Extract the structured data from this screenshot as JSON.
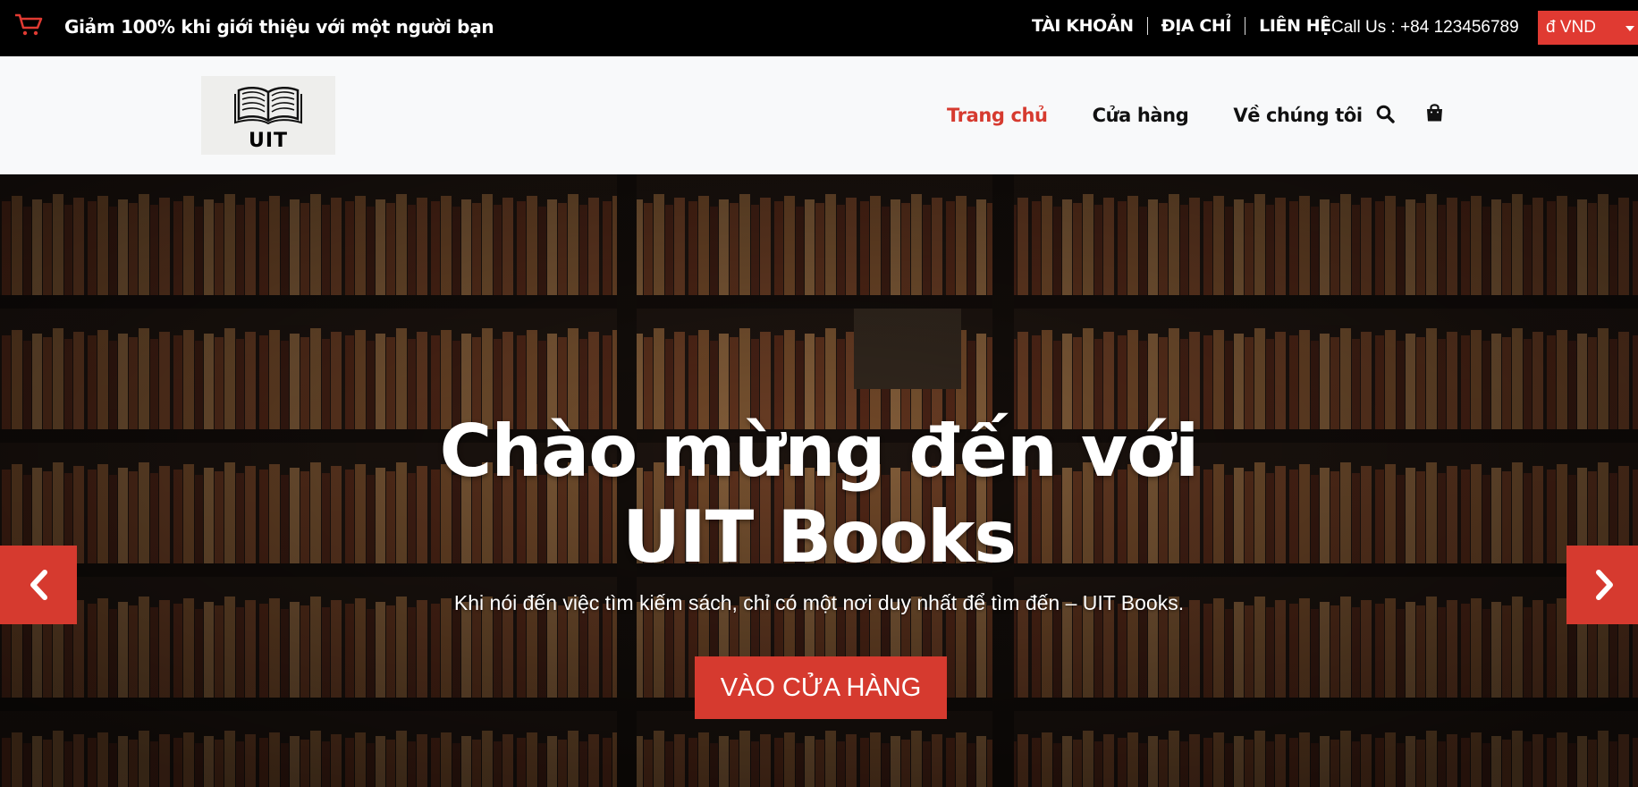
{
  "topbar": {
    "promo_text": "Giảm 100% khi giới thiệu với một người bạn",
    "links": [
      "TÀI KHOẢN",
      "ĐỊA CHỈ",
      "LIÊN HỆ"
    ],
    "phone": "Call Us : +84 123456789",
    "currency": "đ VND",
    "icons": {
      "cart": "cart-icon",
      "currency_caret": "chevron-down-icon"
    }
  },
  "header": {
    "logo_text": "UIT",
    "nav": [
      "Trang chủ",
      "Cửa hàng",
      "Về chúng tôi"
    ],
    "active_nav": "Trang chủ",
    "icons": [
      "search-icon",
      "bag-icon"
    ]
  },
  "hero": {
    "title_line1": "Chào mừng đến với",
    "title_line2": "UIT Books",
    "subtitle": "Khi nói đến việc tìm kiếm sách, chỉ có một nơi duy nhất để tìm đến – UIT Books.",
    "cta_label": "VÀO CỬA HÀNG",
    "prev_icon": "chevron-left-icon",
    "next_icon": "chevron-right-icon"
  },
  "colors": {
    "accent": "#d63a2f",
    "currency_bg": "#e03a32",
    "topbar_bg": "#000000",
    "header_bg": "#f8f9fa"
  }
}
